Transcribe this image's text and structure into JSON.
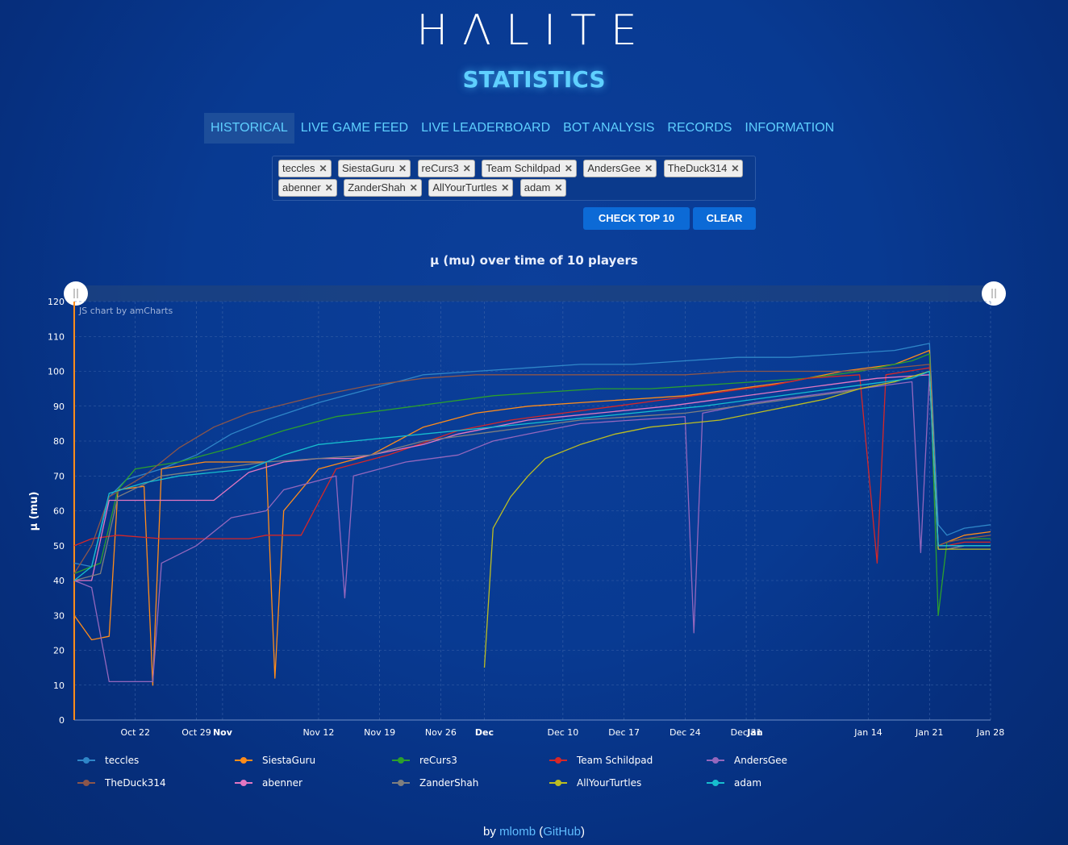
{
  "logo": "HΛLITE",
  "subtitle": "STATISTICS",
  "nav": [
    "HISTORICAL",
    "LIVE GAME FEED",
    "LIVE LEADERBOARD",
    "BOT ANALYSIS",
    "RECORDS",
    "INFORMATION"
  ],
  "tags": [
    "teccles",
    "SiestaGuru",
    "reCurs3",
    "Team Schildpad",
    "AndersGee",
    "TheDuck314",
    "abenner",
    "ZanderShah",
    "AllYourTurtles",
    "adam"
  ],
  "buttons": {
    "check_top": "CHECK TOP 10",
    "clear": "CLEAR"
  },
  "credit": "JS chart by amCharts",
  "footer": {
    "by": "by",
    "author": "mlomb",
    "paren_open": " (",
    "github": "GitHub",
    "paren_close": ")"
  },
  "chart_data": {
    "type": "line",
    "title": "μ (mu) over time of 10 players",
    "ylabel": "μ (mu)",
    "ylim": [
      0,
      120
    ],
    "yticks": [
      0,
      10,
      20,
      30,
      40,
      50,
      60,
      70,
      80,
      90,
      100,
      110,
      120
    ],
    "xticks": [
      {
        "label": "Oct 22",
        "day": 7,
        "bold": false
      },
      {
        "label": "Oct 29",
        "day": 14,
        "bold": false
      },
      {
        "label": "Nov",
        "day": 17,
        "bold": true
      },
      {
        "label": "Nov 12",
        "day": 28,
        "bold": false
      },
      {
        "label": "Nov 19",
        "day": 35,
        "bold": false
      },
      {
        "label": "Nov 26",
        "day": 42,
        "bold": false
      },
      {
        "label": "Dec",
        "day": 47,
        "bold": true
      },
      {
        "label": "Dec 10",
        "day": 56,
        "bold": false
      },
      {
        "label": "Dec 17",
        "day": 63,
        "bold": false
      },
      {
        "label": "Dec 24",
        "day": 70,
        "bold": false
      },
      {
        "label": "Dec 31",
        "day": 77,
        "bold": false
      },
      {
        "label": "Jan",
        "day": 78,
        "bold": true
      },
      {
        "label": "Jan 14",
        "day": 91,
        "bold": false
      },
      {
        "label": "Jan 21",
        "day": 98,
        "bold": false
      },
      {
        "label": "Jan 28",
        "day": 105,
        "bold": false
      }
    ],
    "legend_position": "bottom",
    "series": [
      {
        "name": "teccles",
        "color": "#2f86c8",
        "points": [
          [
            0,
            45
          ],
          [
            2,
            44
          ],
          [
            4,
            64
          ],
          [
            6,
            69
          ],
          [
            10,
            72
          ],
          [
            14,
            76
          ],
          [
            18,
            82
          ],
          [
            22,
            86
          ],
          [
            28,
            91
          ],
          [
            34,
            95
          ],
          [
            40,
            99
          ],
          [
            46,
            100
          ],
          [
            52,
            101
          ],
          [
            58,
            102
          ],
          [
            64,
            102
          ],
          [
            70,
            103
          ],
          [
            76,
            104
          ],
          [
            82,
            104
          ],
          [
            88,
            105
          ],
          [
            94,
            106
          ],
          [
            98,
            108
          ],
          [
            99,
            56
          ],
          [
            100,
            53
          ],
          [
            102,
            55
          ],
          [
            105,
            56
          ]
        ]
      },
      {
        "name": "SiestaGuru",
        "color": "#ff8c1a",
        "points": [
          [
            0,
            30
          ],
          [
            2,
            23
          ],
          [
            4,
            24
          ],
          [
            5,
            66
          ],
          [
            8,
            67
          ],
          [
            9,
            10
          ],
          [
            10,
            72
          ],
          [
            15,
            74
          ],
          [
            22,
            74
          ],
          [
            23,
            12
          ],
          [
            24,
            60
          ],
          [
            28,
            72
          ],
          [
            34,
            76
          ],
          [
            40,
            84
          ],
          [
            46,
            88
          ],
          [
            52,
            90
          ],
          [
            58,
            91
          ],
          [
            64,
            92
          ],
          [
            70,
            93
          ],
          [
            76,
            95
          ],
          [
            82,
            97
          ],
          [
            88,
            100
          ],
          [
            94,
            102
          ],
          [
            98,
            106
          ],
          [
            99,
            50
          ],
          [
            100,
            51
          ],
          [
            102,
            53
          ],
          [
            105,
            54
          ]
        ]
      },
      {
        "name": "reCurs3",
        "color": "#2ca02c",
        "points": [
          [
            0,
            42
          ],
          [
            3,
            45
          ],
          [
            5,
            66
          ],
          [
            7,
            72
          ],
          [
            12,
            74
          ],
          [
            18,
            78
          ],
          [
            24,
            83
          ],
          [
            30,
            87
          ],
          [
            36,
            89
          ],
          [
            42,
            91
          ],
          [
            48,
            93
          ],
          [
            54,
            94
          ],
          [
            60,
            95
          ],
          [
            66,
            95
          ],
          [
            72,
            96
          ],
          [
            78,
            97
          ],
          [
            84,
            98
          ],
          [
            90,
            100
          ],
          [
            96,
            103
          ],
          [
            98,
            105
          ],
          [
            99,
            30
          ],
          [
            100,
            51
          ],
          [
            102,
            52
          ],
          [
            105,
            52
          ]
        ]
      },
      {
        "name": "Team Schildpad",
        "color": "#d62728",
        "points": [
          [
            0,
            50
          ],
          [
            2,
            52
          ],
          [
            5,
            53
          ],
          [
            10,
            52
          ],
          [
            20,
            52
          ],
          [
            22,
            53
          ],
          [
            26,
            53
          ],
          [
            30,
            72
          ],
          [
            36,
            76
          ],
          [
            44,
            83
          ],
          [
            50,
            86
          ],
          [
            56,
            88
          ],
          [
            62,
            90
          ],
          [
            68,
            92
          ],
          [
            74,
            94
          ],
          [
            80,
            96
          ],
          [
            84,
            98
          ],
          [
            90,
            99
          ],
          [
            92,
            45
          ],
          [
            93,
            99
          ],
          [
            98,
            101
          ],
          [
            99,
            50
          ],
          [
            100,
            50
          ],
          [
            102,
            51
          ],
          [
            105,
            51
          ]
        ]
      },
      {
        "name": "AndersGee",
        "color": "#9467bd",
        "points": [
          [
            0,
            40
          ],
          [
            2,
            38
          ],
          [
            4,
            11
          ],
          [
            6,
            11
          ],
          [
            9,
            11
          ],
          [
            10,
            45
          ],
          [
            14,
            50
          ],
          [
            18,
            58
          ],
          [
            22,
            60
          ],
          [
            24,
            66
          ],
          [
            30,
            70
          ],
          [
            31,
            35
          ],
          [
            32,
            70
          ],
          [
            38,
            74
          ],
          [
            44,
            76
          ],
          [
            48,
            80
          ],
          [
            52,
            82
          ],
          [
            58,
            85
          ],
          [
            64,
            86
          ],
          [
            70,
            87
          ],
          [
            71,
            25
          ],
          [
            72,
            88
          ],
          [
            78,
            91
          ],
          [
            84,
            93
          ],
          [
            90,
            95
          ],
          [
            96,
            97
          ],
          [
            97,
            48
          ],
          [
            98,
            99
          ],
          [
            99,
            49
          ],
          [
            100,
            49
          ],
          [
            102,
            50
          ],
          [
            105,
            50
          ]
        ]
      },
      {
        "name": "TheDuck314",
        "color": "#8c564b",
        "points": [
          [
            0,
            42
          ],
          [
            2,
            50
          ],
          [
            4,
            64
          ],
          [
            8,
            70
          ],
          [
            12,
            78
          ],
          [
            16,
            84
          ],
          [
            20,
            88
          ],
          [
            28,
            93
          ],
          [
            34,
            96
          ],
          [
            40,
            98
          ],
          [
            46,
            99
          ],
          [
            52,
            99
          ],
          [
            58,
            99
          ],
          [
            64,
            99
          ],
          [
            70,
            99
          ],
          [
            76,
            100
          ],
          [
            82,
            100
          ],
          [
            88,
            100
          ],
          [
            94,
            101
          ],
          [
            98,
            102
          ],
          [
            99,
            50
          ],
          [
            100,
            51
          ],
          [
            102,
            52
          ],
          [
            105,
            53
          ]
        ]
      },
      {
        "name": "abenner",
        "color": "#e377c2",
        "points": [
          [
            0,
            40
          ],
          [
            2,
            40
          ],
          [
            4,
            63
          ],
          [
            8,
            63
          ],
          [
            12,
            63
          ],
          [
            16,
            63
          ],
          [
            20,
            71
          ],
          [
            24,
            74
          ],
          [
            28,
            75
          ],
          [
            32,
            75
          ],
          [
            36,
            77
          ],
          [
            40,
            79
          ],
          [
            44,
            82
          ],
          [
            48,
            84
          ],
          [
            52,
            86
          ],
          [
            56,
            87
          ],
          [
            60,
            88
          ],
          [
            64,
            89
          ],
          [
            68,
            90
          ],
          [
            74,
            92
          ],
          [
            80,
            94
          ],
          [
            86,
            96
          ],
          [
            92,
            98
          ],
          [
            98,
            99
          ],
          [
            99,
            50
          ],
          [
            100,
            50
          ],
          [
            102,
            50
          ],
          [
            105,
            50
          ]
        ]
      },
      {
        "name": "ZanderShah",
        "color": "#7f7f7f",
        "points": [
          [
            0,
            40
          ],
          [
            3,
            42
          ],
          [
            5,
            64
          ],
          [
            10,
            70
          ],
          [
            16,
            72
          ],
          [
            22,
            74
          ],
          [
            28,
            75
          ],
          [
            34,
            76
          ],
          [
            40,
            80
          ],
          [
            46,
            82
          ],
          [
            52,
            84
          ],
          [
            58,
            86
          ],
          [
            64,
            87
          ],
          [
            70,
            88
          ],
          [
            76,
            90
          ],
          [
            82,
            92
          ],
          [
            88,
            94
          ],
          [
            94,
            97
          ],
          [
            98,
            100
          ],
          [
            99,
            49
          ],
          [
            100,
            49
          ],
          [
            102,
            50
          ],
          [
            105,
            50
          ]
        ]
      },
      {
        "name": "AllYourTurtles",
        "color": "#bcbd22",
        "points": [
          [
            47,
            15
          ],
          [
            48,
            55
          ],
          [
            50,
            64
          ],
          [
            52,
            70
          ],
          [
            54,
            75
          ],
          [
            58,
            79
          ],
          [
            62,
            82
          ],
          [
            66,
            84
          ],
          [
            70,
            85
          ],
          [
            74,
            86
          ],
          [
            78,
            88
          ],
          [
            82,
            90
          ],
          [
            86,
            92
          ],
          [
            90,
            95
          ],
          [
            94,
            97
          ],
          [
            98,
            100
          ],
          [
            99,
            49
          ],
          [
            100,
            49
          ],
          [
            102,
            49
          ],
          [
            105,
            49
          ]
        ]
      },
      {
        "name": "adam",
        "color": "#17becf",
        "points": [
          [
            0,
            40
          ],
          [
            2,
            44
          ],
          [
            4,
            65
          ],
          [
            8,
            68
          ],
          [
            12,
            70
          ],
          [
            16,
            71
          ],
          [
            20,
            72
          ],
          [
            24,
            76
          ],
          [
            28,
            79
          ],
          [
            32,
            80
          ],
          [
            36,
            81
          ],
          [
            40,
            82
          ],
          [
            44,
            83
          ],
          [
            48,
            84
          ],
          [
            52,
            85
          ],
          [
            56,
            86
          ],
          [
            60,
            87
          ],
          [
            64,
            88
          ],
          [
            68,
            89
          ],
          [
            72,
            90
          ],
          [
            78,
            92
          ],
          [
            84,
            94
          ],
          [
            90,
            96
          ],
          [
            96,
            98
          ],
          [
            98,
            100
          ],
          [
            99,
            50
          ],
          [
            100,
            50
          ],
          [
            102,
            50
          ],
          [
            105,
            50
          ]
        ]
      }
    ]
  }
}
